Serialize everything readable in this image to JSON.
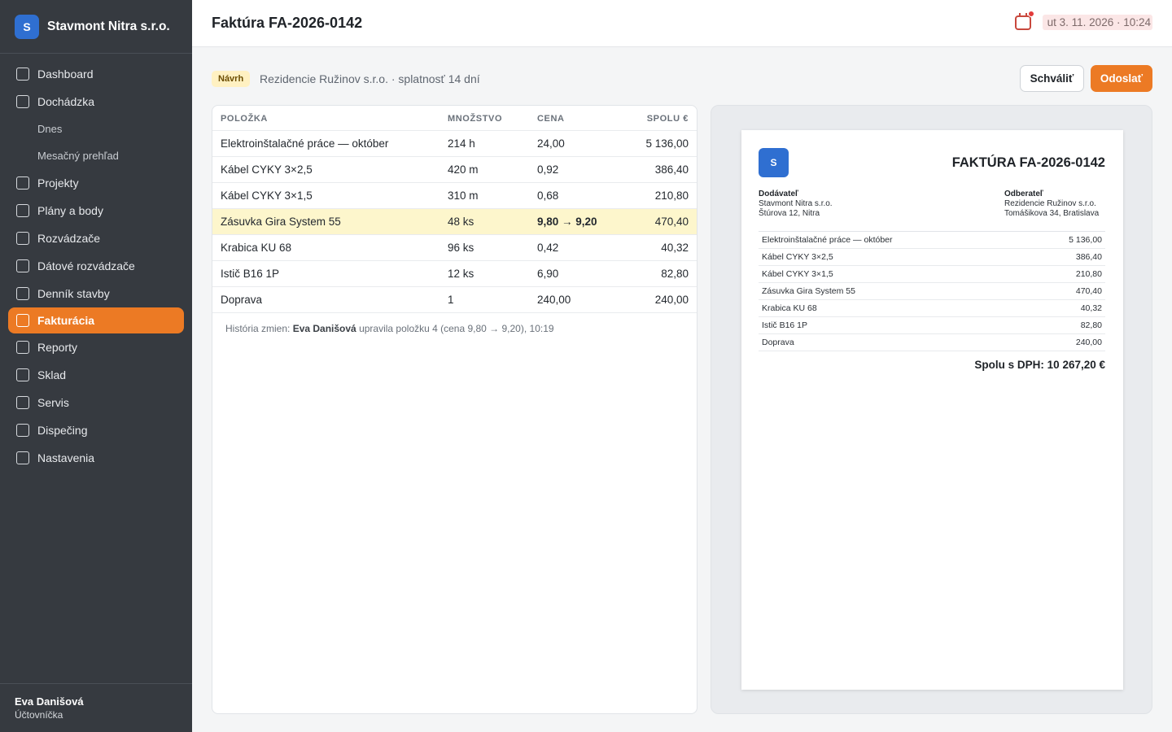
{
  "sidebar": {
    "brand": {
      "logo_letter": "S",
      "name": "Stavmont Nitra s.r.o."
    },
    "items": [
      {
        "label": "Dashboard"
      },
      {
        "label": "Dochádzka"
      },
      {
        "label": "Dnes",
        "sub": true
      },
      {
        "label": "Mesačný prehľad",
        "sub": true
      },
      {
        "label": "Projekty"
      },
      {
        "label": "Plány a body"
      },
      {
        "label": "Rozvádzače"
      },
      {
        "label": "Dátové rozvádzače"
      },
      {
        "label": "Denník stavby"
      },
      {
        "label": "Fakturácia",
        "active": true
      },
      {
        "label": "Reporty"
      },
      {
        "label": "Sklad"
      },
      {
        "label": "Servis"
      },
      {
        "label": "Dispečing"
      },
      {
        "label": "Nastavenia"
      }
    ],
    "user": {
      "name": "Eva Danišová",
      "role": "Účtovníčka"
    }
  },
  "header": {
    "title": "Faktúra FA-2026-0142",
    "datetime": "ut 3. 11. 2026 · 10:24"
  },
  "toolbar": {
    "status_badge": "Návrh",
    "meta": "Rezidencie Ružinov s.r.o. · splatnosť 14 dní",
    "approve_label": "Schváliť",
    "send_label": "Odoslať"
  },
  "table": {
    "columns": [
      "POLOŽKA",
      "MNOŽSTVO",
      "CENA",
      "SPOLU €"
    ],
    "rows": [
      {
        "item": "Elektroinštalačné práce — október",
        "qty": "214 h",
        "price": "24,00",
        "total": "5 136,00"
      },
      {
        "item": "Kábel CYKY 3×2,5",
        "qty": "420 m",
        "price": "0,92",
        "total": "386,40"
      },
      {
        "item": "Kábel CYKY 3×1,5",
        "qty": "310 m",
        "price": "0,68",
        "total": "210,80"
      },
      {
        "item": "Zásuvka Gira System 55",
        "qty": "48 ks",
        "price": "9,80 → 9,20",
        "total": "470,40",
        "highlight": true
      },
      {
        "item": "Krabica KU 68",
        "qty": "96 ks",
        "price": "0,42",
        "total": "40,32"
      },
      {
        "item": "Istič B16 1P",
        "qty": "12 ks",
        "price": "6,90",
        "total": "82,80"
      },
      {
        "item": "Doprava",
        "qty": "1",
        "price": "240,00",
        "total": "240,00"
      }
    ],
    "history": {
      "prefix": "História zmien: ",
      "user": "Eva Danišová",
      "text": " upravila položku 4 (cena 9,80 → 9,20), 10:19"
    }
  },
  "preview": {
    "logo_letter": "S",
    "title": "FAKTÚRA FA-2026-0142",
    "supplier": {
      "label": "Dodávateľ",
      "name": "Stavmont Nitra s.r.o.",
      "address": "Štúrova 12, Nitra"
    },
    "customer": {
      "label": "Odberateľ",
      "name": "Rezidencie Ružinov s.r.o.",
      "address": "Tomášikova 34, Bratislava"
    },
    "rows": [
      {
        "name": "Elektroinštalačné práce — október",
        "total": "5 136,00"
      },
      {
        "name": "Kábel CYKY 3×2,5",
        "total": "386,40"
      },
      {
        "name": "Kábel CYKY 3×1,5",
        "total": "210,80"
      },
      {
        "name": "Zásuvka Gira System 55",
        "total": "470,40"
      },
      {
        "name": "Krabica KU 68",
        "total": "40,32"
      },
      {
        "name": "Istič B16 1P",
        "total": "82,80"
      },
      {
        "name": "Doprava",
        "total": "240,00"
      }
    ],
    "total": "Spolu s DPH: 10 267,20 €"
  },
  "colors": {
    "accent": "#ec7a24",
    "sidebar_bg": "#363a40",
    "brand_blue": "#2f6fd1",
    "highlight_row": "#fdf6cc",
    "draft_badge": "#fff1c2"
  },
  "icons": {
    "nav_item": "checkbox-square-icon",
    "header_calendar": "calendar-icon",
    "notification_dot": "notification-dot-icon"
  }
}
